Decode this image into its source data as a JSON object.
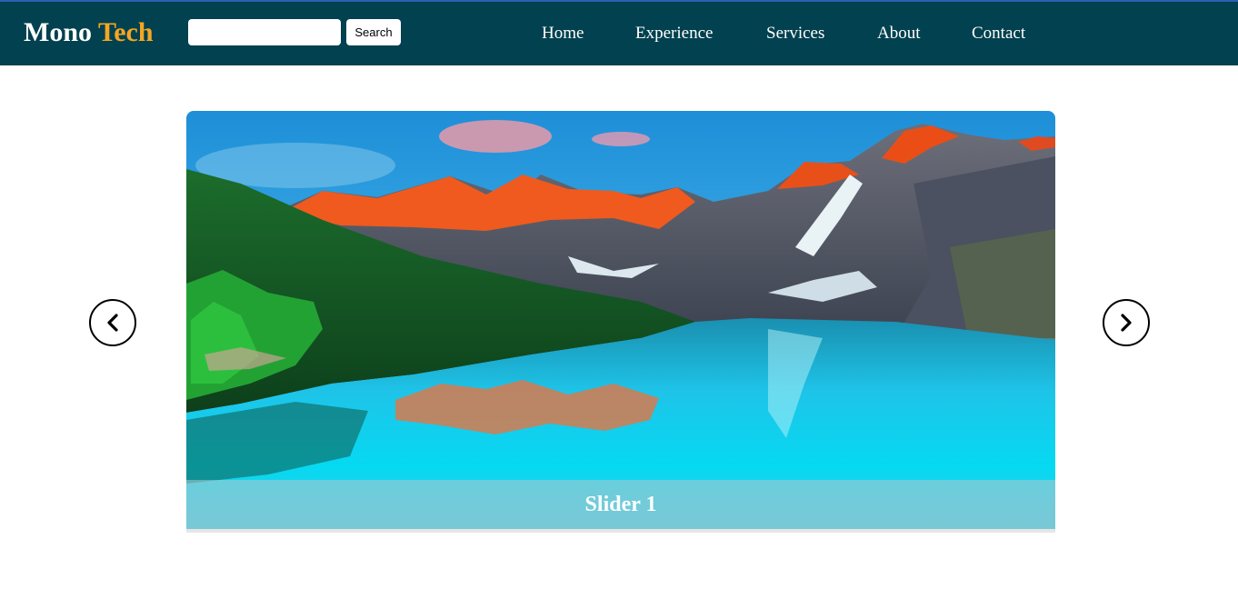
{
  "header": {
    "brand_first": "Mono",
    "brand_second": "Tech",
    "search": {
      "value": "",
      "placeholder": "",
      "button_label": "Search"
    },
    "nav": [
      {
        "label": "Home"
      },
      {
        "label": "Experience"
      },
      {
        "label": "Services"
      },
      {
        "label": "About"
      },
      {
        "label": "Contact"
      }
    ]
  },
  "slider": {
    "caption": "Slider 1",
    "prev_icon": "chevron-left-icon",
    "next_icon": "chevron-right-icon"
  },
  "colors": {
    "header_bg": "#02414f",
    "brand_accent": "#f5a623",
    "text_light": "#ffffff"
  }
}
